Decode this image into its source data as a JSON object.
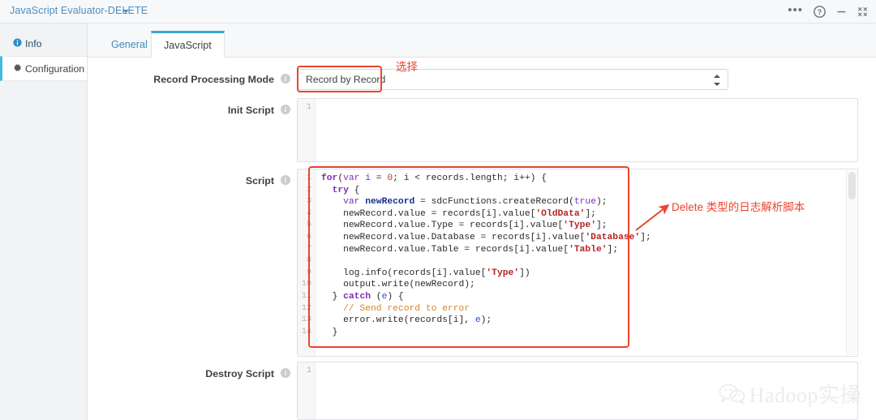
{
  "titlebar": {
    "title": "JavaScript Evaluator-DELETE",
    "caret_icon": "chevron-down-icon",
    "controls": [
      {
        "name": "more-options-icon",
        "glyph": "•••"
      },
      {
        "name": "help-icon",
        "glyph": "?"
      },
      {
        "name": "minimize-icon",
        "glyph": "—"
      },
      {
        "name": "collapse-icon",
        "glyph": "⤡"
      }
    ]
  },
  "sidebar": {
    "items": [
      {
        "label": "Info",
        "icon": "info-icon",
        "active": false
      },
      {
        "label": "Configuration",
        "icon": "gear-icon",
        "active": true
      }
    ]
  },
  "tabs": [
    {
      "label": "General",
      "active": false
    },
    {
      "label": "JavaScript",
      "active": true
    }
  ],
  "form": {
    "record_processing_mode": {
      "label": "Record Processing Mode",
      "info_icon": "info-icon",
      "value": "Record by Record",
      "spinner_icon": "spinner-arrows-icon"
    },
    "init_script": {
      "label": "Init Script",
      "info_icon": "info-icon",
      "lines": [
        ""
      ],
      "line_numbers": [
        "1"
      ]
    },
    "script": {
      "label": "Script",
      "info_icon": "info-icon",
      "line_numbers": [
        "1",
        "2",
        "3",
        "4",
        "5",
        "6",
        "7",
        "8",
        "9",
        "10",
        "11",
        "12",
        "13",
        "14"
      ],
      "code_lines": [
        [
          {
            "t": "for",
            "c": "kw2"
          },
          {
            "t": "(",
            "c": "plain"
          },
          {
            "t": "var",
            "c": "kw"
          },
          {
            "t": " ",
            "c": "plain"
          },
          {
            "t": "i",
            "c": "var"
          },
          {
            "t": " = ",
            "c": "plain"
          },
          {
            "t": "0",
            "c": "num"
          },
          {
            "t": "; i < records.length; i++) {",
            "c": "plain"
          }
        ],
        [
          {
            "t": "  ",
            "c": "plain"
          },
          {
            "t": "try",
            "c": "kw2"
          },
          {
            "t": " {",
            "c": "plain"
          }
        ],
        [
          {
            "t": "    ",
            "c": "plain"
          },
          {
            "t": "var",
            "c": "kw"
          },
          {
            "t": " ",
            "c": "plain"
          },
          {
            "t": "newRecord",
            "c": "decl"
          },
          {
            "t": " = sdcFunctions.createRecord(",
            "c": "plain"
          },
          {
            "t": "true",
            "c": "kw"
          },
          {
            "t": ");",
            "c": "plain"
          }
        ],
        [
          {
            "t": "    newRecord.value = records[i].value[",
            "c": "plain"
          },
          {
            "t": "'OldData'",
            "c": "str"
          },
          {
            "t": "];",
            "c": "plain"
          }
        ],
        [
          {
            "t": "    newRecord.value.Type = records[i].value[",
            "c": "plain"
          },
          {
            "t": "'Type'",
            "c": "str"
          },
          {
            "t": "];",
            "c": "plain"
          }
        ],
        [
          {
            "t": "    newRecord.value.Database = records[i].value[",
            "c": "plain"
          },
          {
            "t": "'Database'",
            "c": "str"
          },
          {
            "t": "];",
            "c": "plain"
          }
        ],
        [
          {
            "t": "    newRecord.value.Table = records[i].value[",
            "c": "plain"
          },
          {
            "t": "'Table'",
            "c": "str"
          },
          {
            "t": "];",
            "c": "plain"
          }
        ],
        [
          {
            "t": "",
            "c": "plain"
          }
        ],
        [
          {
            "t": "    log.info(records[i].value[",
            "c": "plain"
          },
          {
            "t": "'Type'",
            "c": "str"
          },
          {
            "t": "])",
            "c": "plain"
          }
        ],
        [
          {
            "t": "    output.write(newRecord);",
            "c": "plain"
          }
        ],
        [
          {
            "t": "  } ",
            "c": "plain"
          },
          {
            "t": "catch",
            "c": "kw2"
          },
          {
            "t": " (",
            "c": "plain"
          },
          {
            "t": "e",
            "c": "var"
          },
          {
            "t": ") {",
            "c": "plain"
          }
        ],
        [
          {
            "t": "    ",
            "c": "plain"
          },
          {
            "t": "// Send record to error",
            "c": "cmt"
          }
        ],
        [
          {
            "t": "    error.write(records[i], ",
            "c": "plain"
          },
          {
            "t": "e",
            "c": "var"
          },
          {
            "t": ");",
            "c": "plain"
          }
        ],
        [
          {
            "t": "  }",
            "c": "plain"
          }
        ]
      ]
    },
    "destroy_script": {
      "label": "Destroy Script",
      "info_icon": "info-icon",
      "line_numbers": [
        "1"
      ]
    }
  },
  "annotations": {
    "select_note": "选择",
    "script_note": "Delete 类型的日志解析脚本",
    "color": "#ea442e"
  },
  "watermark": {
    "icon": "wechat-icon",
    "text": "Hadoop实操"
  }
}
